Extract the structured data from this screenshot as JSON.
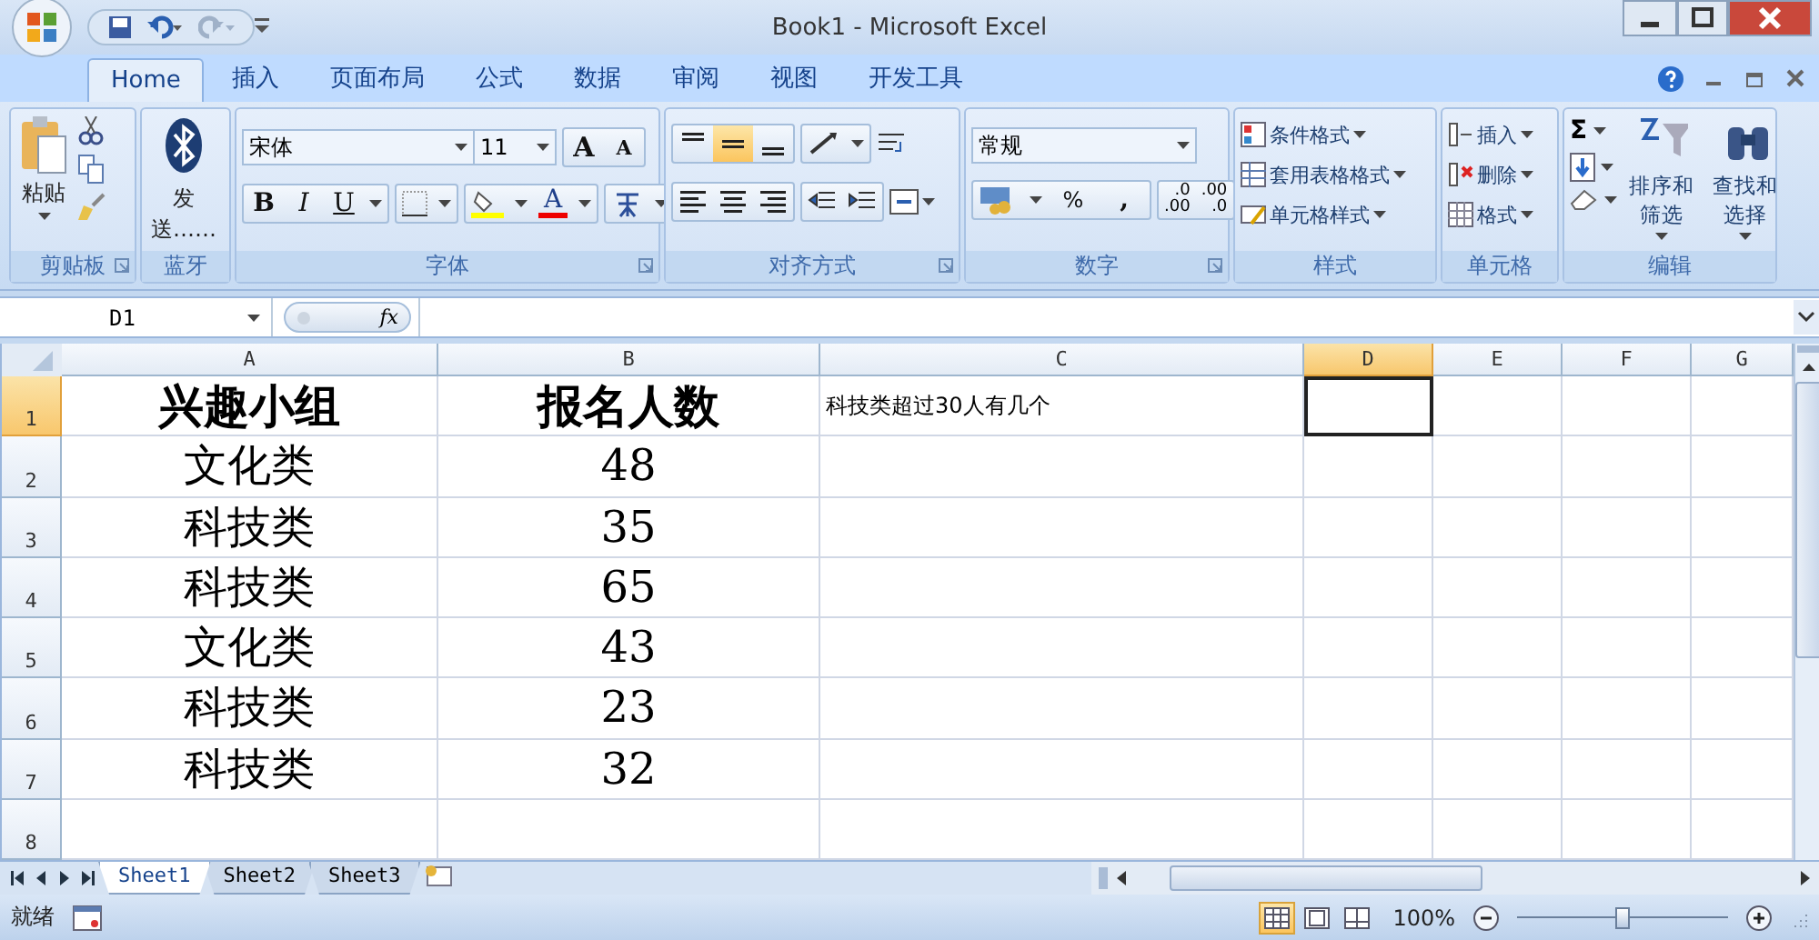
{
  "window": {
    "title": "Book1 - Microsoft Excel"
  },
  "tabs": [
    {
      "label": "Home",
      "selected": true
    },
    {
      "label": "插入",
      "selected": false
    },
    {
      "label": "页面布局",
      "selected": false
    },
    {
      "label": "公式",
      "selected": false
    },
    {
      "label": "数据",
      "selected": false
    },
    {
      "label": "审阅",
      "selected": false
    },
    {
      "label": "视图",
      "selected": false
    },
    {
      "label": "开发工具",
      "selected": false
    }
  ],
  "ribbon": {
    "groups": [
      {
        "kind": "clipboard",
        "label": "剪贴板",
        "launcher": true,
        "paste": "粘贴"
      },
      {
        "kind": "bluetooth",
        "label": "蓝牙",
        "launcher": false,
        "send_lines": [
          "发",
          "送……"
        ]
      },
      {
        "kind": "font",
        "label": "字体",
        "launcher": true,
        "font_name": "宋体",
        "font_size": "11",
        "grow": "A",
        "shrink": "A",
        "bold": "B",
        "italic": "I",
        "underline": "U",
        "font_color": "A"
      },
      {
        "kind": "alignment",
        "label": "对齐方式",
        "launcher": true,
        "vertical": [
          {
            "selected": false
          },
          {
            "selected": true
          },
          {
            "selected": false
          }
        ],
        "horizontal": [
          {
            "selected": false
          },
          {
            "selected": false
          },
          {
            "selected": false
          }
        ]
      },
      {
        "kind": "number",
        "label": "数字",
        "launcher": true,
        "format": "常规",
        "percent": "%",
        "comma": ",",
        "increase_decimal": [
          ".0",
          ".00"
        ],
        "decrease_decimal": [
          ".00",
          ".0"
        ]
      },
      {
        "kind": "styles",
        "label": "样式",
        "launcher": false,
        "commands": [
          "条件格式",
          "套用表格格式",
          "单元格样式"
        ]
      },
      {
        "kind": "cells",
        "label": "单元格",
        "launcher": false,
        "commands": [
          "插入",
          "删除",
          "格式"
        ]
      },
      {
        "kind": "editing",
        "label": "编辑",
        "launcher": false,
        "sum": "Σ",
        "sort": "排序和筛选",
        "find": "查找和选择"
      }
    ]
  },
  "formula_bar": {
    "name_box": "D1",
    "fx": "fx"
  },
  "sheet": {
    "columns": [
      {
        "label": "A",
        "selected": false
      },
      {
        "label": "B",
        "selected": false
      },
      {
        "label": "C",
        "selected": false
      },
      {
        "label": "D",
        "selected": true
      },
      {
        "label": "E",
        "selected": false
      },
      {
        "label": "F",
        "selected": false
      },
      {
        "label": "G",
        "selected": false
      }
    ],
    "rows": [
      {
        "label": "1",
        "selected": true,
        "cells": [
          {
            "text": "兴趣小组",
            "kind": "header"
          },
          {
            "text": "报名人数",
            "kind": "header"
          },
          {
            "text": "科技类超过30人有几个",
            "kind": "note"
          },
          {
            "selected": true
          }
        ]
      },
      {
        "label": "2",
        "selected": false,
        "cells": [
          {
            "text": "文化类",
            "kind": "value"
          },
          {
            "text": "48",
            "kind": "value"
          }
        ]
      },
      {
        "label": "3",
        "selected": false,
        "cells": [
          {
            "text": "科技类",
            "kind": "value"
          },
          {
            "text": "35",
            "kind": "value"
          }
        ]
      },
      {
        "label": "4",
        "selected": false,
        "cells": [
          {
            "text": "科技类",
            "kind": "value"
          },
          {
            "text": "65",
            "kind": "value"
          }
        ]
      },
      {
        "label": "5",
        "selected": false,
        "cells": [
          {
            "text": "文化类",
            "kind": "value"
          },
          {
            "text": "43",
            "kind": "value"
          }
        ]
      },
      {
        "label": "6",
        "selected": false,
        "cells": [
          {
            "text": "科技类",
            "kind": "value"
          },
          {
            "text": "23",
            "kind": "value"
          }
        ]
      },
      {
        "label": "7",
        "selected": false,
        "cells": [
          {
            "text": "科技类",
            "kind": "value"
          },
          {
            "text": "32",
            "kind": "value"
          }
        ]
      },
      {
        "label": "8",
        "selected": false,
        "cells": []
      }
    ]
  },
  "sheet_tabs": [
    {
      "label": "Sheet1",
      "selected": true
    },
    {
      "label": "Sheet2",
      "selected": false
    },
    {
      "label": "Sheet3",
      "selected": false
    }
  ],
  "status_bar": {
    "status": "就绪",
    "views": [
      {
        "selected": true
      },
      {
        "selected": false
      },
      {
        "selected": false
      }
    ],
    "zoom": "100%",
    "zoom_slider": {
      "level": 0.5
    }
  }
}
